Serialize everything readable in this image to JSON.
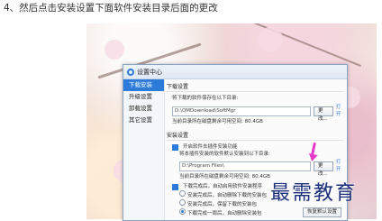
{
  "step_text": "4、然后点击安装设置下面软件安装目录后面的更改",
  "dialog": {
    "title": "设置中心",
    "sidebar": [
      "下载安装",
      "升级设置",
      "卸载设置",
      "其它设置"
    ],
    "download_section": "下载设置",
    "download_prompt": "将下载的软件保存在以下目录:",
    "download_path": "D:\\QMDownload\\SoftMgr",
    "change_label": "更改...",
    "open_label": "打开",
    "download_space": "当前目录所在磁盘剩余可用空间: 80.4GB",
    "install_section": "安装设置",
    "auto_install_label": "开启软件去插件安装功能",
    "install_prompt": "将本插件安装的软件默认安装到以下目录:",
    "install_path": "D:\\Program Files\\",
    "install_space": "当前目录所在磁盘剩余可用空间: 80.4GB",
    "after_download_label": "下载完成后，自动启用软件安装程序",
    "radio_1": "安装完成后，自动删除下载的安装包",
    "radio_2": "安装完成后，保留下载的安装包",
    "radio_3": "下载完成一周后，自动删除安装包",
    "reset_label": "恢复默认设置"
  },
  "watermark": "最需教育"
}
